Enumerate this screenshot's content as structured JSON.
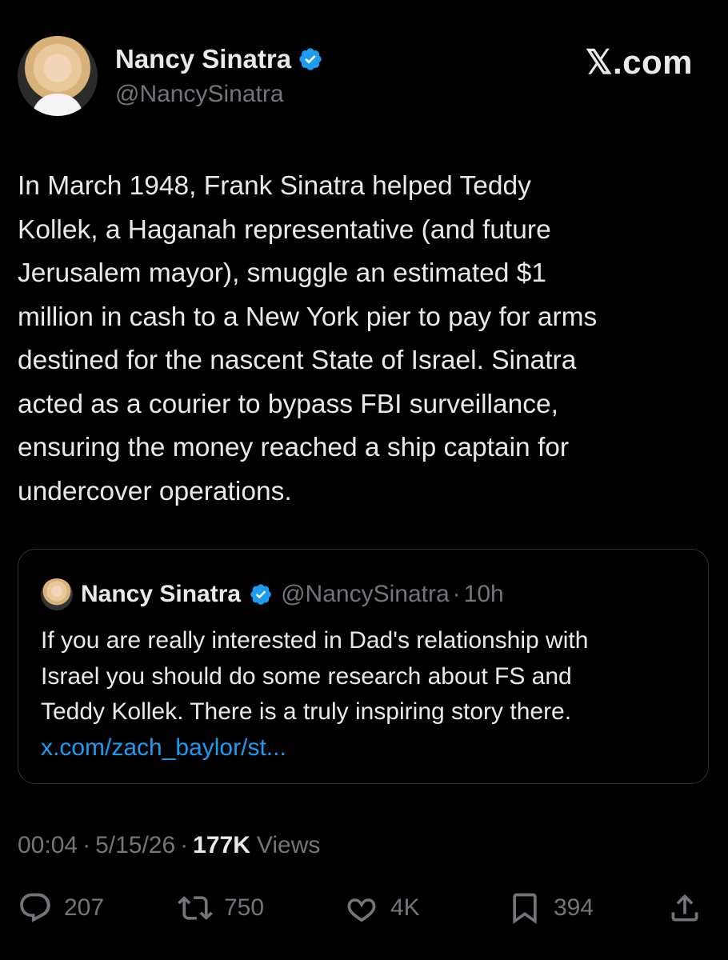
{
  "author": {
    "name": "Nancy Sinatra",
    "handle": "@NancySinatra",
    "verified_icon": "verified-badge-icon",
    "accent": "#1d9bf0"
  },
  "brand": "𝕏.com",
  "post": {
    "lines": [
      "In March 1948, Frank Sinatra helped Teddy",
      "Kollek, a Haganah representative (and future",
      "Jerusalem mayor), smuggle an estimated $1",
      "million in cash to a New York pier to pay for arms",
      "destined for the nascent State of Israel. Sinatra",
      "acted as a courier to bypass FBI surveillance,",
      "ensuring the money reached a ship captain for",
      "undercover operations."
    ]
  },
  "quote": {
    "name": "Nancy Sinatra",
    "handle": "@NancySinatra",
    "sep": "·",
    "time": "10h",
    "lines": [
      "If you are really interested in Dad's relationship with",
      "Israel you should do some research about FS and",
      "Teddy Kollek. There is a truly inspiring story there."
    ],
    "link": "x.com/zach_baylor/st..."
  },
  "meta": {
    "time": "00:04",
    "sep": "·",
    "date": "5/15/26",
    "views_count": "177K",
    "views_label": "Views"
  },
  "actions": {
    "replies": "207",
    "reposts": "750",
    "likes": "4K",
    "bookmarks": "394"
  },
  "colors": {
    "background": "#000000",
    "text": "#e7e9ea",
    "muted": "#71767b",
    "link": "#1d9bf0",
    "border": "#2f3336"
  }
}
